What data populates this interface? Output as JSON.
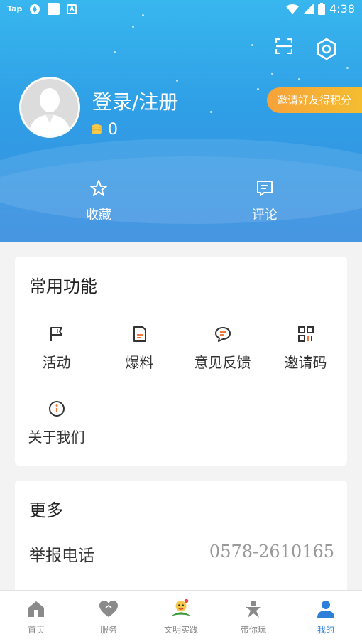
{
  "status_bar": {
    "app_label": "Tap",
    "time": "4:38"
  },
  "profile": {
    "login_label": "登录/注册",
    "points": "0",
    "invite_button": "邀请好友得积分"
  },
  "quick_actions": [
    {
      "label": "收藏"
    },
    {
      "label": "评论"
    }
  ],
  "common_functions": {
    "title": "常用功能",
    "items": [
      {
        "label": "活动"
      },
      {
        "label": "爆料"
      },
      {
        "label": "意见反馈"
      },
      {
        "label": "邀请码"
      },
      {
        "label": "关于我们"
      }
    ]
  },
  "more": {
    "title": "更多",
    "report_label": "举报电话",
    "report_phone": "0578-2610165"
  },
  "tabs": [
    {
      "label": "首页"
    },
    {
      "label": "服务"
    },
    {
      "label": "文明实践"
    },
    {
      "label": "带你玩"
    },
    {
      "label": "我的"
    }
  ],
  "colors": {
    "header": "#38b6ee",
    "accent": "#2d7fd7",
    "invite": "#f6a23a",
    "icon_orange": "#f07a3a"
  }
}
